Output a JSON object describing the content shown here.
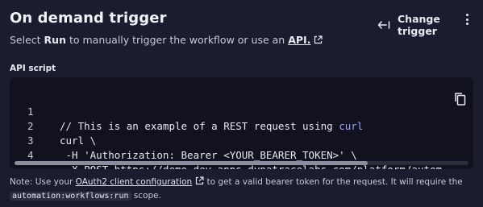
{
  "header": {
    "title": "On demand trigger",
    "change_trigger_label": "Change trigger",
    "change_trigger_icon": "arrow-left-icon",
    "menu_icon": "kebab-menu-icon"
  },
  "subtitle": {
    "prefix": "Select ",
    "run_label": "Run",
    "middle": " to manually trigger the workflow or use an ",
    "link": "API.",
    "link_icon": "external-link-icon"
  },
  "api_script": {
    "label": "API script",
    "copy_icon": "copy-icon",
    "lines": [
      {
        "num": "1",
        "text": "// This is an example of a REST request using ",
        "highlight": "curl"
      },
      {
        "num": "2",
        "text": "curl \\",
        "highlight": ""
      },
      {
        "num": "3",
        "text": " -H 'Authorization: Bearer <YOUR_BEARER_TOKEN>' \\",
        "highlight": ""
      },
      {
        "num": "4",
        "text": " -X POST https://demo.dev.apps.dynatracelabs.com/platform/autom",
        "highlight": ""
      }
    ]
  },
  "note": {
    "prefix": "Note: Use your ",
    "link": "OAuth2 client configuration",
    "middle": " to get a valid bearer token for the request. It will require the",
    "code": "automation:workflows:run",
    "suffix": " scope."
  },
  "colors": {
    "background": "#1b1c2e",
    "code_background": "#11121e",
    "keyword": "#9aa7ff",
    "text": "#e7e8f0"
  }
}
